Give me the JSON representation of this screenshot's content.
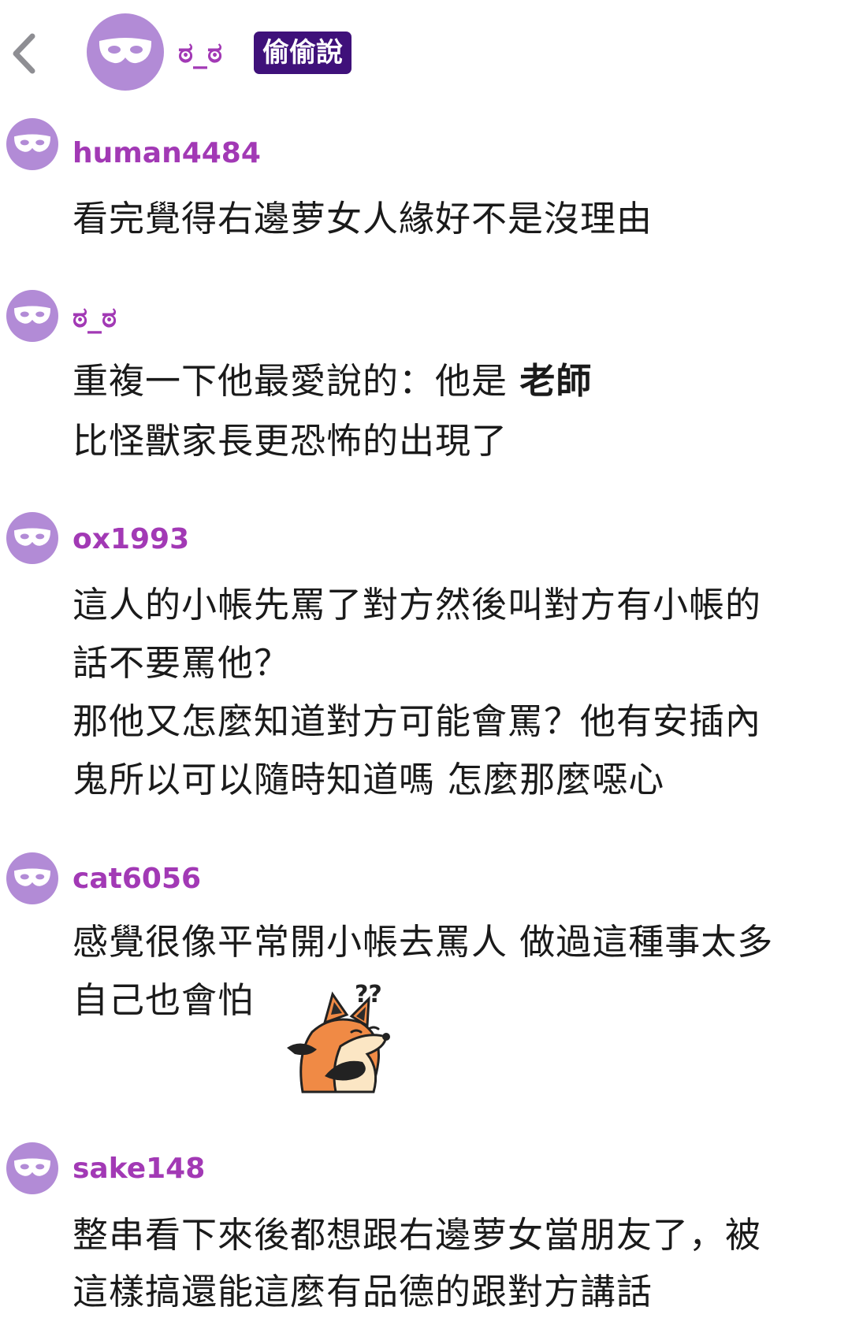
{
  "header": {
    "author": "ಠ_ಠ",
    "badge": "偷偷說"
  },
  "comments": [
    {
      "username": "human4484",
      "lines": [
        "看完覺得右邊萝女人緣好不是沒理由"
      ]
    },
    {
      "username": "ಠ_ಠ",
      "line1_prefix": "重複一下他最愛說的：他是 ",
      "line1_bold": "老師",
      "line2": "比怪獸家長更恐怖的出現了"
    },
    {
      "username": "ox1993",
      "lines": [
        "這人的小帳先罵了對方然後叫對方有小帳的",
        "話不要罵他？",
        "那他又怎麼知道對方可能會罵？他有安插內",
        "鬼所以可以隨時知道嗎 怎麼那麼噁心"
      ]
    },
    {
      "username": "cat6056",
      "lines": [
        "感覺很像平常開小帳去罵人 做過這種事太多",
        "自己也會怕"
      ],
      "sticker": "fox-confused-sticker",
      "sticker_text": "??"
    },
    {
      "username": "sake148",
      "lines": [
        "整串看下來後都想跟右邊萝女當朋友了，被",
        "這樣搞還能這麼有品德的跟對方講話"
      ]
    }
  ],
  "colors": {
    "accent": "#a239b5",
    "avatar": "#b28bd6",
    "badge_bg": "#3f117a"
  }
}
